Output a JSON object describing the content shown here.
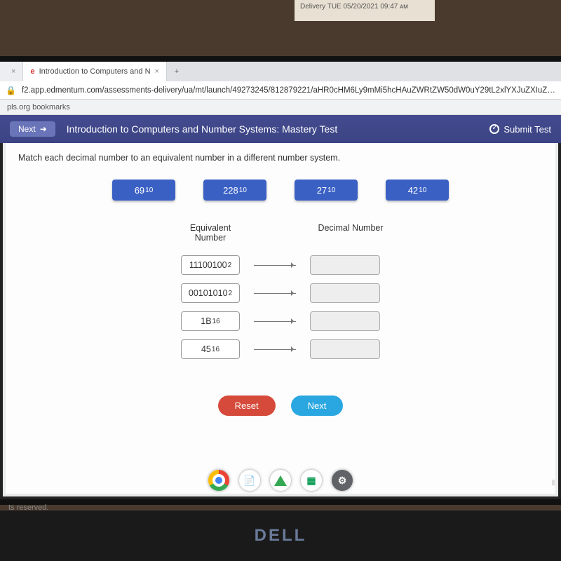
{
  "tag_text": "Delivery   TUE  05/20/2021 09:47 ᴀᴍ",
  "browser": {
    "tabs": [
      {
        "title": " ",
        "close": "×"
      },
      {
        "title": "Introduction to Computers and N",
        "icon": "e",
        "close": "×"
      }
    ],
    "newtab": "+",
    "url": "f2.app.edmentum.com/assessments-delivery/ua/mt/launch/49273245/812879221/aHR0cHM6Ly9mMi5hcHAuZWRtZW50dW0uY29tL2xlYXJuZXIuZXItdWkvc2Vjb25kY",
    "bookmark_text": "pls.org bookmarks"
  },
  "app": {
    "next_label": "Next",
    "next_icon": "➜",
    "title": "Introduction to Computers and Number Systems: Mastery Test",
    "submit_label": "Submit Test"
  },
  "question": {
    "instruction": "Match each decimal number to an equivalent number in a different number system.",
    "chips": [
      {
        "value": "69",
        "base": "10"
      },
      {
        "value": "228",
        "base": "10"
      },
      {
        "value": "27",
        "base": "10"
      },
      {
        "value": "42",
        "base": "10"
      }
    ],
    "col1": "Equivalent\nNumber",
    "col2": "Decimal Number",
    "rows": [
      {
        "value": "11100100",
        "base": "2"
      },
      {
        "value": "00101010",
        "base": "2"
      },
      {
        "value": "1B",
        "base": "16"
      },
      {
        "value": "45",
        "base": "16"
      }
    ],
    "reset": "Reset",
    "next": "Next"
  },
  "footer": "ts reserved.",
  "dell": "DELL"
}
